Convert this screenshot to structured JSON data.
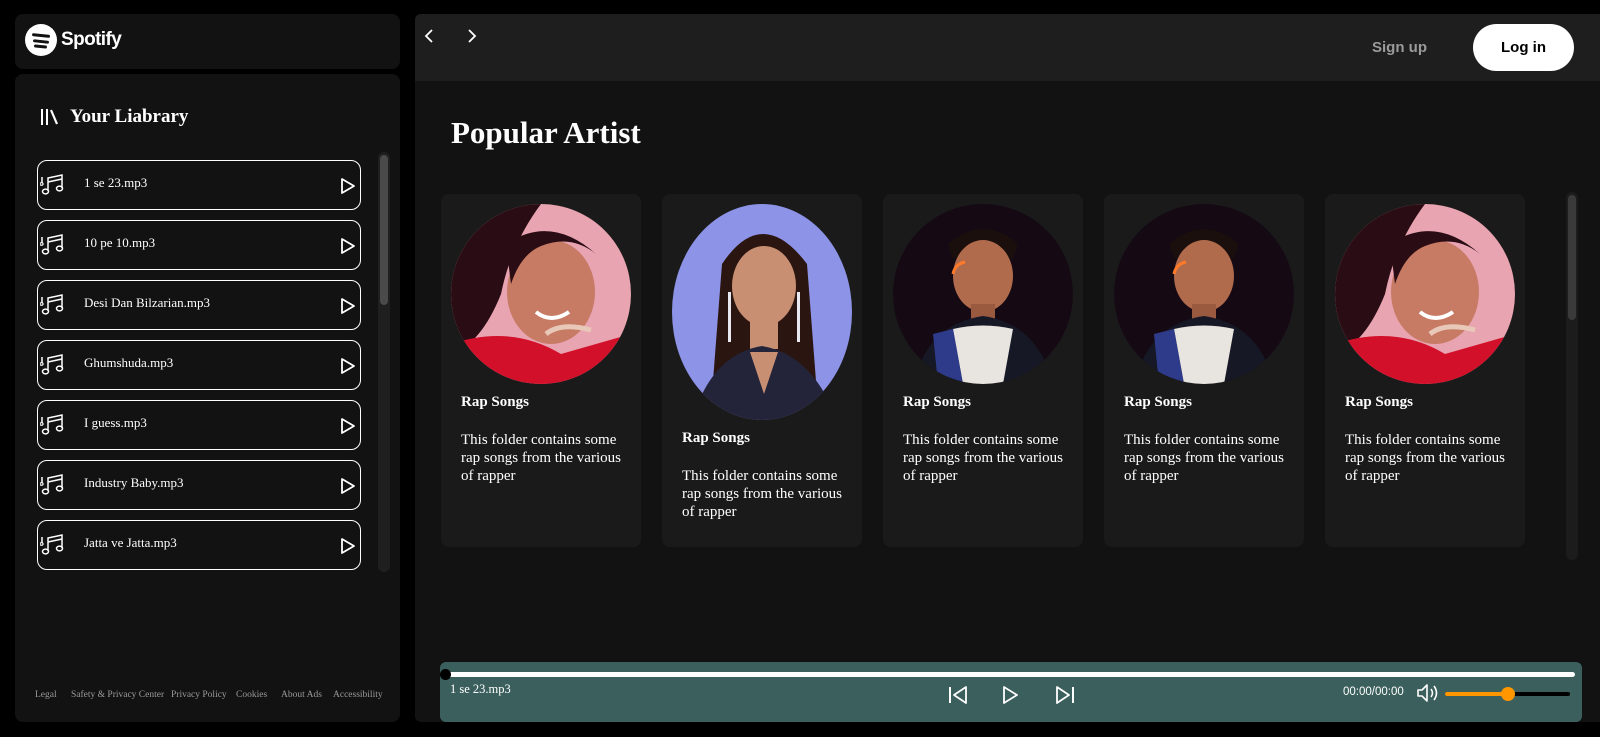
{
  "brand": {
    "name": "Spotify"
  },
  "library": {
    "title": "Your Liabrary",
    "songs": [
      {
        "name": "1 se 23.mp3"
      },
      {
        "name": "10 pe 10.mp3"
      },
      {
        "name": "Desi Dan Bilzarian.mp3"
      },
      {
        "name": "Ghumshuda.mp3"
      },
      {
        "name": "I guess.mp3"
      },
      {
        "name": "Industry Baby.mp3"
      },
      {
        "name": "Jatta ve Jatta.mp3"
      }
    ]
  },
  "footer": {
    "links": [
      "Legal",
      "Safety & Privacy Center",
      "Privacy Policy",
      "Cookies",
      "About Ads",
      "Accessibility"
    ]
  },
  "header": {
    "signup_label": "Sign up",
    "login_label": "Log in"
  },
  "main": {
    "section_title": "Popular Artist",
    "cards": [
      {
        "title": "Rap Songs",
        "description": "This folder contains some rap songs from the various of rapper"
      },
      {
        "title": "Rap Songs",
        "description": "This folder contains some rap songs from the various of rapper"
      },
      {
        "title": "Rap Songs",
        "description": "This folder contains some rap songs from the various of rapper"
      },
      {
        "title": "Rap Songs",
        "description": "This folder contains some rap songs from the various of rapper"
      },
      {
        "title": "Rap Songs",
        "description": "This folder contains some rap songs from the various of rapper"
      }
    ]
  },
  "player": {
    "current_song": "1 se 23.mp3",
    "time": "00:00/00:00",
    "progress": 0,
    "volume": 0.5
  },
  "colors": {
    "player_bg": "#3a5f5c",
    "volume_accent": "#ff9600"
  }
}
